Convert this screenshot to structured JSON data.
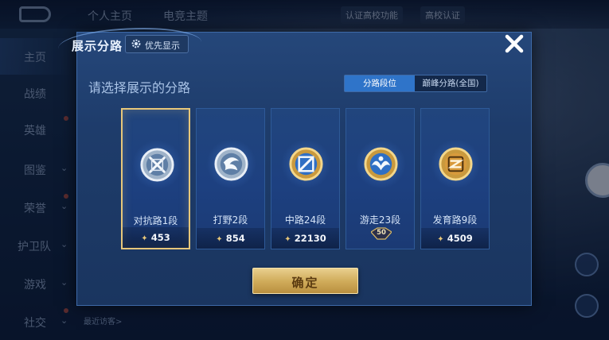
{
  "background": {
    "tabs": [
      "个人主页",
      "电竞主题"
    ],
    "verify_text": "认证高校功能",
    "campus_badge": "高校认证",
    "sidebar_items": [
      {
        "label": "主页",
        "active": true
      },
      {
        "label": "战绩"
      },
      {
        "label": "英雄"
      },
      {
        "label": "图鉴"
      },
      {
        "label": "荣誉"
      },
      {
        "label": "护卫队"
      },
      {
        "label": "游戏"
      },
      {
        "label": "社交"
      }
    ],
    "recent_visitors": "最近访客>"
  },
  "dialog": {
    "title": "展示分路",
    "priority_label": "优先显示",
    "subtitle": "请选择展示的分路",
    "segments": [
      {
        "label": "分路段位",
        "active": true
      },
      {
        "label": "巅峰分路(全国)",
        "active": false
      }
    ],
    "cards": [
      {
        "lane": "对抗路1段",
        "score": "453",
        "selected": true,
        "icon": "sword-shield-icon",
        "tier": "silver"
      },
      {
        "lane": "打野2段",
        "score": "854",
        "selected": false,
        "icon": "claw-icon",
        "tier": "silver"
      },
      {
        "lane": "中路24段",
        "score": "22130",
        "selected": false,
        "icon": "staff-icon",
        "tier": "gold"
      },
      {
        "lane": "游走23段",
        "score": "",
        "selected": false,
        "icon": "guardian-icon",
        "tier": "gold",
        "badge": "50"
      },
      {
        "lane": "发育路9段",
        "score": "4509",
        "selected": false,
        "icon": "bow-icon",
        "tier": "gold"
      }
    ],
    "confirm_label": "确定"
  },
  "colors": {
    "accent": "#2f74c9",
    "gold": "#e7c77a",
    "dialog_bg": "#1e3c6b"
  }
}
